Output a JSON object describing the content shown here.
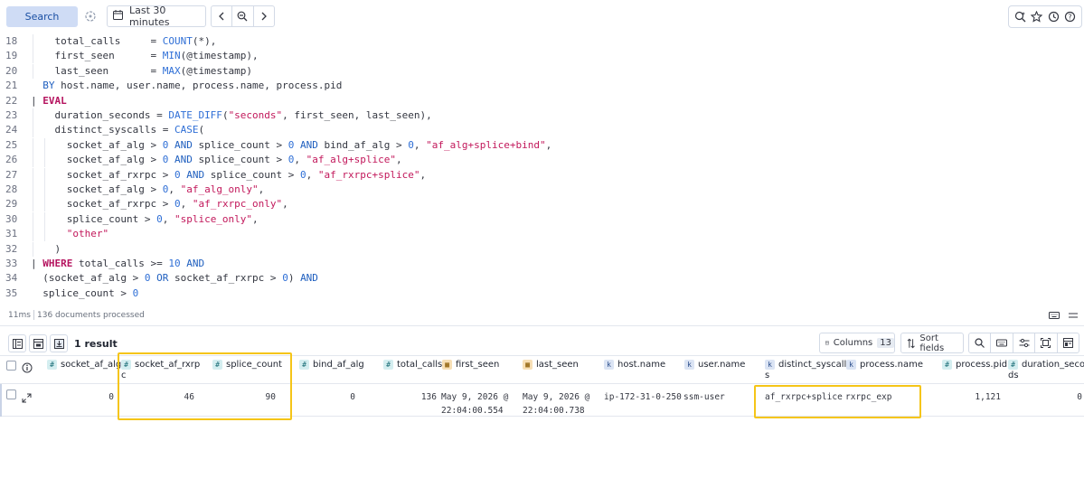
{
  "toolbar": {
    "search_label": "Search",
    "date_range": "Last 30 minutes"
  },
  "editor": {
    "lines": [
      {
        "n": "18",
        "indent": 1,
        "t": [
          [
            "    total_calls     = ",
            "plain"
          ],
          [
            "COUNT",
            "fn"
          ],
          [
            "(*),",
            "plain"
          ]
        ]
      },
      {
        "n": "19",
        "indent": 1,
        "t": [
          [
            "    first_seen      = ",
            "plain"
          ],
          [
            "MIN",
            "fn"
          ],
          [
            "(@timestamp),",
            "plain"
          ]
        ]
      },
      {
        "n": "20",
        "indent": 1,
        "t": [
          [
            "    last_seen       = ",
            "plain"
          ],
          [
            "MAX",
            "fn"
          ],
          [
            "(@timestamp)",
            "plain"
          ]
        ]
      },
      {
        "n": "21",
        "indent": 0,
        "t": [
          [
            "  ",
            "plain"
          ],
          [
            "BY",
            "kw"
          ],
          [
            " host.name, user.name, process.name, process.pid",
            "plain"
          ]
        ]
      },
      {
        "n": "22",
        "indent": 0,
        "t": [
          [
            "| ",
            "plain"
          ],
          [
            "EVAL",
            "kwr"
          ]
        ]
      },
      {
        "n": "23",
        "indent": 1,
        "t": [
          [
            "    duration_seconds = ",
            "plain"
          ],
          [
            "DATE_DIFF",
            "fn"
          ],
          [
            "(",
            "plain"
          ],
          [
            "\"seconds\"",
            "str"
          ],
          [
            ", first_seen, last_seen),",
            "plain"
          ]
        ]
      },
      {
        "n": "24",
        "indent": 1,
        "t": [
          [
            "    distinct_syscalls = ",
            "plain"
          ],
          [
            "CASE",
            "fn"
          ],
          [
            "(",
            "plain"
          ]
        ]
      },
      {
        "n": "25",
        "indent": 2,
        "t": [
          [
            "      socket_af_alg > ",
            "plain"
          ],
          [
            "0",
            "num"
          ],
          [
            " ",
            "plain"
          ],
          [
            "AND",
            "kw"
          ],
          [
            " splice_count > ",
            "plain"
          ],
          [
            "0",
            "num"
          ],
          [
            " ",
            "plain"
          ],
          [
            "AND",
            "kw"
          ],
          [
            " bind_af_alg > ",
            "plain"
          ],
          [
            "0",
            "num"
          ],
          [
            ", ",
            "plain"
          ],
          [
            "\"af_alg+splice+bind\"",
            "str"
          ],
          [
            ",",
            "plain"
          ]
        ]
      },
      {
        "n": "26",
        "indent": 2,
        "t": [
          [
            "      socket_af_alg > ",
            "plain"
          ],
          [
            "0",
            "num"
          ],
          [
            " ",
            "plain"
          ],
          [
            "AND",
            "kw"
          ],
          [
            " splice_count > ",
            "plain"
          ],
          [
            "0",
            "num"
          ],
          [
            ", ",
            "plain"
          ],
          [
            "\"af_alg+splice\"",
            "str"
          ],
          [
            ",",
            "plain"
          ]
        ]
      },
      {
        "n": "27",
        "indent": 2,
        "t": [
          [
            "      socket_af_rxrpc > ",
            "plain"
          ],
          [
            "0",
            "num"
          ],
          [
            " ",
            "plain"
          ],
          [
            "AND",
            "kw"
          ],
          [
            " splice_count > ",
            "plain"
          ],
          [
            "0",
            "num"
          ],
          [
            ", ",
            "plain"
          ],
          [
            "\"af_rxrpc+splice\"",
            "str"
          ],
          [
            ",",
            "plain"
          ]
        ]
      },
      {
        "n": "28",
        "indent": 2,
        "t": [
          [
            "      socket_af_alg > ",
            "plain"
          ],
          [
            "0",
            "num"
          ],
          [
            ", ",
            "plain"
          ],
          [
            "\"af_alg_only\"",
            "str"
          ],
          [
            ",",
            "plain"
          ]
        ]
      },
      {
        "n": "29",
        "indent": 2,
        "t": [
          [
            "      socket_af_rxrpc > ",
            "plain"
          ],
          [
            "0",
            "num"
          ],
          [
            ", ",
            "plain"
          ],
          [
            "\"af_rxrpc_only\"",
            "str"
          ],
          [
            ",",
            "plain"
          ]
        ]
      },
      {
        "n": "30",
        "indent": 2,
        "t": [
          [
            "      splice_count > ",
            "plain"
          ],
          [
            "0",
            "num"
          ],
          [
            ", ",
            "plain"
          ],
          [
            "\"splice_only\"",
            "str"
          ],
          [
            ",",
            "plain"
          ]
        ]
      },
      {
        "n": "31",
        "indent": 2,
        "t": [
          [
            "      ",
            "plain"
          ],
          [
            "\"other\"",
            "str"
          ]
        ]
      },
      {
        "n": "32",
        "indent": 1,
        "t": [
          [
            "    )",
            "plain"
          ]
        ]
      },
      {
        "n": "33",
        "indent": 0,
        "t": [
          [
            "| ",
            "plain"
          ],
          [
            "WHERE",
            "kwr"
          ],
          [
            " total_calls >= ",
            "plain"
          ],
          [
            "10",
            "num"
          ],
          [
            " ",
            "plain"
          ],
          [
            "AND",
            "kw"
          ]
        ]
      },
      {
        "n": "34",
        "indent": 0,
        "t": [
          [
            "  (socket_af_alg > ",
            "plain"
          ],
          [
            "0",
            "num"
          ],
          [
            " ",
            "plain"
          ],
          [
            "OR",
            "kw"
          ],
          [
            " socket_af_rxrpc > ",
            "plain"
          ],
          [
            "0",
            "num"
          ],
          [
            ") ",
            "plain"
          ],
          [
            "AND",
            "kw"
          ]
        ]
      },
      {
        "n": "35",
        "indent": 0,
        "t": [
          [
            "  splice_count > ",
            "plain"
          ],
          [
            "0",
            "num"
          ]
        ]
      }
    ],
    "colors": {
      "plain": "#343741",
      "fn": "#2f6fd6",
      "kw": "#1f5fbf",
      "kwr": "#b5135f",
      "str": "#c2185b",
      "num": "#2f6fd6"
    }
  },
  "status": {
    "time": "11ms",
    "docs": "136 documents processed"
  },
  "results": {
    "count_label": "1 result",
    "columns_label": "Columns",
    "columns_count": "13",
    "sort_label": "Sort fields"
  },
  "grid": {
    "columns": [
      {
        "name": "socket_af_alg",
        "type": "num",
        "lines": [
          "socket_af_alg"
        ]
      },
      {
        "name": "socket_af_rxrpc",
        "type": "num",
        "lines": [
          "socket_af_rxrp",
          "c"
        ]
      },
      {
        "name": "splice_count",
        "type": "num",
        "lines": [
          "splice_count"
        ]
      },
      {
        "name": "bind_af_alg",
        "type": "num",
        "lines": [
          "bind_af_alg"
        ]
      },
      {
        "name": "total_calls",
        "type": "num",
        "lines": [
          "total_calls"
        ]
      },
      {
        "name": "first_seen",
        "type": "date",
        "lines": [
          "first_seen"
        ]
      },
      {
        "name": "last_seen",
        "type": "date",
        "lines": [
          "last_seen"
        ]
      },
      {
        "name": "host.name",
        "type": "kw",
        "lines": [
          "host.name"
        ]
      },
      {
        "name": "user.name",
        "type": "kw",
        "lines": [
          "user.name"
        ]
      },
      {
        "name": "distinct_syscalls",
        "type": "kw",
        "lines": [
          "distinct_syscall",
          "s"
        ]
      },
      {
        "name": "process.name",
        "type": "kw",
        "lines": [
          "process.name"
        ]
      },
      {
        "name": "process.pid",
        "type": "num",
        "lines": [
          "process.pid"
        ]
      },
      {
        "name": "duration_seconds",
        "type": "num",
        "lines": [
          "duration_secon",
          "ds"
        ]
      }
    ],
    "row": {
      "socket_af_alg": "0",
      "socket_af_rxrpc": "46",
      "splice_count": "90",
      "bind_af_alg": "0",
      "total_calls": "136",
      "first_seen": "May 9, 2026 @\n22:04:00.554",
      "last_seen": "May 9, 2026 @\n22:04:00.738",
      "host_name": "ip-172-31-0-250",
      "user_name": "ssm-user",
      "distinct_syscalls": "af_rxrpc+splice",
      "process_name": "rxrpc_exp",
      "process_pid": "1,121",
      "duration_seconds": "0"
    },
    "type_icons": {
      "num": "#",
      "kw": "k",
      "date": "▦"
    },
    "highlight_color": "#f5c518"
  }
}
